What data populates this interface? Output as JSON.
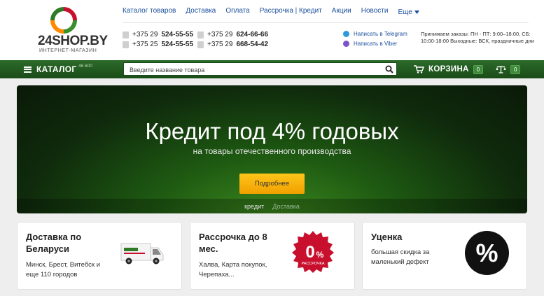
{
  "logo": {
    "text": "24SHOP.BY",
    "subtitle": "ИНТЕРНЕТ-МАГАЗИН"
  },
  "topnav": {
    "items": [
      "Каталог товаров",
      "Доставка",
      "Оплата",
      "Рассрочка | Кредит",
      "Акции",
      "Новости"
    ],
    "more_label": "Еще"
  },
  "phones": {
    "p1": {
      "prefix": "+375 29 ",
      "number": "524-55-55"
    },
    "p2": {
      "prefix": "+375 25 ",
      "number": "524-55-55"
    },
    "p3": {
      "prefix": "+375 29 ",
      "number": "624-66-66"
    },
    "p4": {
      "prefix": "+375 29 ",
      "number": "668-54-42"
    }
  },
  "messengers": {
    "telegram": "Написать в Telegram",
    "viber": "Написать в Viber"
  },
  "hours": "Принимаем заказы: ПН - ПТ: 9:00–18:00, СБ: 10:00-18:00 Выходные: ВСК, праздничные дни",
  "greenbar": {
    "catalog_label": "КАТАЛОГ",
    "catalog_count": "46 600",
    "search_placeholder": "Введите название товара",
    "cart_label": "КОРЗИНА",
    "cart_count": "0",
    "compare_count": "0"
  },
  "banner": {
    "title": "Кредит под 4% годовых",
    "subtitle": "на товары отечественного производства",
    "button": "Подробнее",
    "tabs": [
      "кредит",
      "Доставка"
    ],
    "active_tab": 0
  },
  "cards": [
    {
      "title": "Доставка по Беларуси",
      "text": "Минск, Брест, Витебск и еще 110 городов",
      "icon": "delivery-truck"
    },
    {
      "title": "Рассрочка до 8 мес.",
      "text": "Халва, Карта покупок, Черепаха...",
      "icon": "zero-percent-badge",
      "badge_big": "0",
      "badge_pct": "%",
      "badge_small": "РАССРОЧКА"
    },
    {
      "title": "Уценка",
      "text": "большая скидка за маленький дефект",
      "icon": "percent-circle",
      "badge": "%"
    }
  ],
  "colors": {
    "green_dark": "#1a4c18",
    "accent_yellow": "#f0a000",
    "link_blue": "#1a4f9c",
    "badge_red": "#c8102e"
  }
}
